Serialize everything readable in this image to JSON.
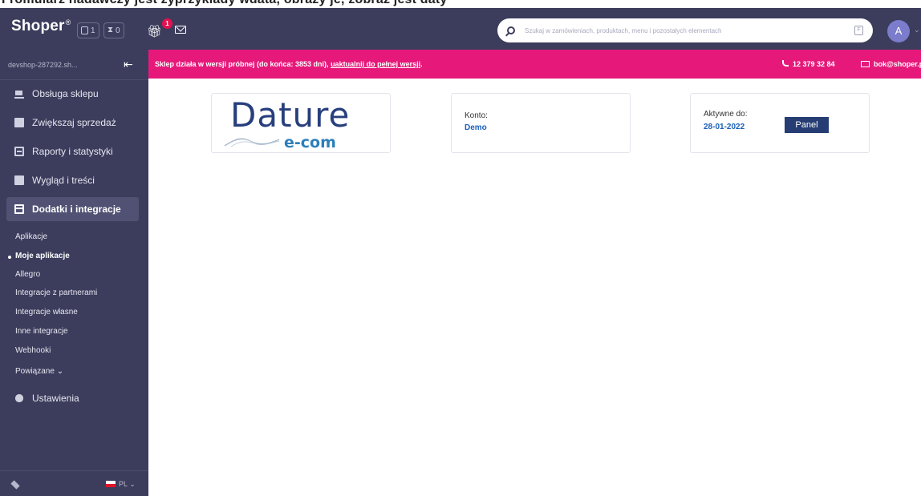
{
  "top_strip": {
    "text": "Fromularz nadawczy jest zyprzykłady wdata, obrazy je, zobraz jest daty"
  },
  "topbar": {
    "logo": "Shoper",
    "logo_mark": "®",
    "counter_orders": "1",
    "counter_pending": "0",
    "gift_badge": "1",
    "search_placeholder": "Szukaj w zamówieniach, produktach, menu i pozostałych elementach",
    "search_key_hint": "F",
    "avatar_initial": "A"
  },
  "sidebar": {
    "shop_name": "devshop-287292.sh...",
    "nav": [
      {
        "label": "Obsługa sklepu",
        "icon": "cart-icon"
      },
      {
        "label": "Zwiększaj sprzedaż",
        "icon": "chart-icon"
      },
      {
        "label": "Raporty i statystyki",
        "icon": "report-icon"
      },
      {
        "label": "Wygląd i treści",
        "icon": "image-icon"
      },
      {
        "label": "Dodatki i integracje",
        "icon": "window-icon",
        "active": true
      }
    ],
    "sub": [
      {
        "label": "Aplikacje"
      },
      {
        "label": "Moje aplikacje",
        "current": true
      },
      {
        "label": "Allegro"
      },
      {
        "label": "Integracje z partnerami"
      },
      {
        "label": "Integracje własne"
      },
      {
        "label": "Inne integracje"
      },
      {
        "label": "Webhooki"
      },
      {
        "label": "Powiązane"
      }
    ],
    "settings": "Ustawienia",
    "language": "PL"
  },
  "alert": {
    "message": "Sklep działa w wersji próbnej (do końca: 3853 dni), ",
    "link": "uaktualnij do pełnej wersji",
    "link_suffix": ".",
    "phone": "12 379 32 84",
    "email": "bok@shoper.p"
  },
  "cards": {
    "logo_main": "Dature",
    "logo_sub": "e-com",
    "konto_label": "Konto:",
    "konto_value": "Demo",
    "active_label": "Aktywne do:",
    "active_value": "28-01-2022",
    "panel_button": "Panel"
  },
  "colors": {
    "sidebar": "#3c3d5c",
    "alert": "#e6197a",
    "accent_blue": "#1b5fb7",
    "panel_button": "#263d73"
  }
}
